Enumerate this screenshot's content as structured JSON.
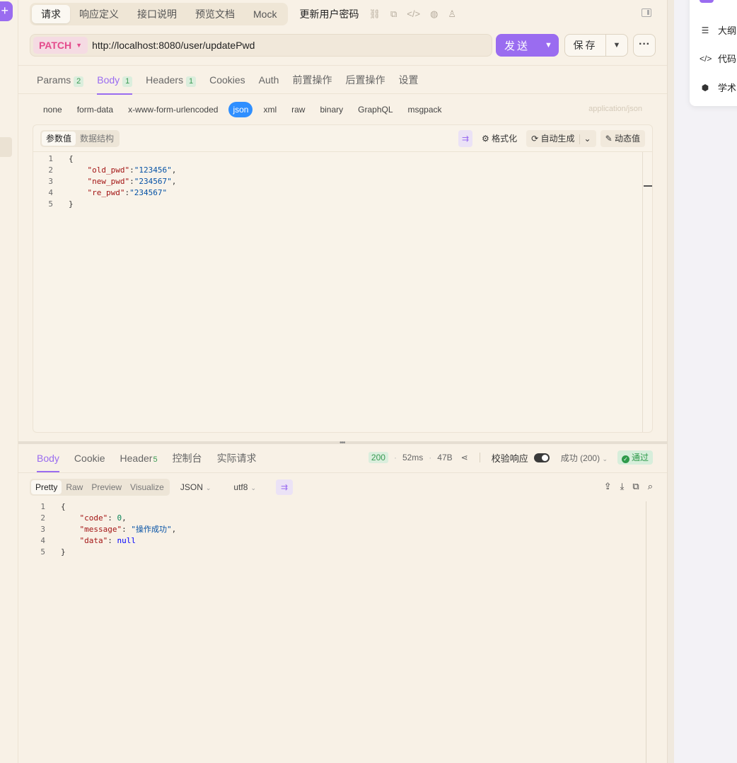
{
  "sidebar": {
    "add_label": "+"
  },
  "top_tabs": [
    {
      "label": "请求",
      "active": true
    },
    {
      "label": "响应定义"
    },
    {
      "label": "接口说明"
    },
    {
      "label": "预览文档"
    },
    {
      "label": "Mock"
    }
  ],
  "doc_title": "更新用户密码",
  "request": {
    "method": "PATCH",
    "url": "http://localhost:8080/user/updatePwd",
    "send_label": "发送",
    "save_label": "保存",
    "more_label": "···"
  },
  "req_tabs": [
    {
      "label": "Params",
      "badge": "2"
    },
    {
      "label": "Body",
      "badge": "1",
      "active": true
    },
    {
      "label": "Headers",
      "badge": "1"
    },
    {
      "label": "Cookies"
    },
    {
      "label": "Auth"
    },
    {
      "label": "前置操作"
    },
    {
      "label": "后置操作"
    },
    {
      "label": "设置"
    }
  ],
  "body_types": [
    "none",
    "form-data",
    "x-www-form-urlencoded",
    "json",
    "xml",
    "raw",
    "binary",
    "GraphQL",
    "msgpack"
  ],
  "body_type_active": "json",
  "content_type": "application/json",
  "editor": {
    "mode_tabs": [
      "参数值",
      "数据结构"
    ],
    "format_label": "格式化",
    "autogen_label": "自动生成",
    "dynamic_label": "动态值",
    "lines": [
      "1",
      "2",
      "3",
      "4",
      "5"
    ],
    "fields": [
      {
        "key": "\"old_pwd\"",
        "value": "\"123456\"",
        "trail": ","
      },
      {
        "key": "\"new_pwd\"",
        "value": "\"234567\"",
        "trail": ","
      },
      {
        "key": "\"re_pwd\"",
        "value": "\"234567\"",
        "trail": ""
      }
    ]
  },
  "resp_tabs": [
    {
      "label": "Body",
      "active": true
    },
    {
      "label": "Cookie"
    },
    {
      "label": "Header",
      "badge": "5"
    },
    {
      "label": "控制台"
    },
    {
      "label": "实际请求"
    }
  ],
  "resp_meta": {
    "status": "200",
    "time": "52ms",
    "size": "47B",
    "validate_label": "校验响应",
    "result_select": "成功 (200)",
    "pass_label": "通过"
  },
  "resp_view": {
    "modes": [
      "Pretty",
      "Raw",
      "Preview",
      "Visualize"
    ],
    "format": "JSON",
    "encoding": "utf8"
  },
  "response": {
    "lines": [
      "1",
      "2",
      "3",
      "4",
      "5"
    ],
    "code_key": "\"code\"",
    "code_val": "0",
    "message_key": "\"message\"",
    "message_val": "\"操作成功\"",
    "data_key": "\"data\"",
    "data_val": "null"
  },
  "right_panel": {
    "items": [
      {
        "icon": "list-icon",
        "label": "大纲"
      },
      {
        "icon": "code-icon",
        "label": "代码"
      },
      {
        "icon": "academic-icon",
        "label": "学术"
      }
    ]
  }
}
